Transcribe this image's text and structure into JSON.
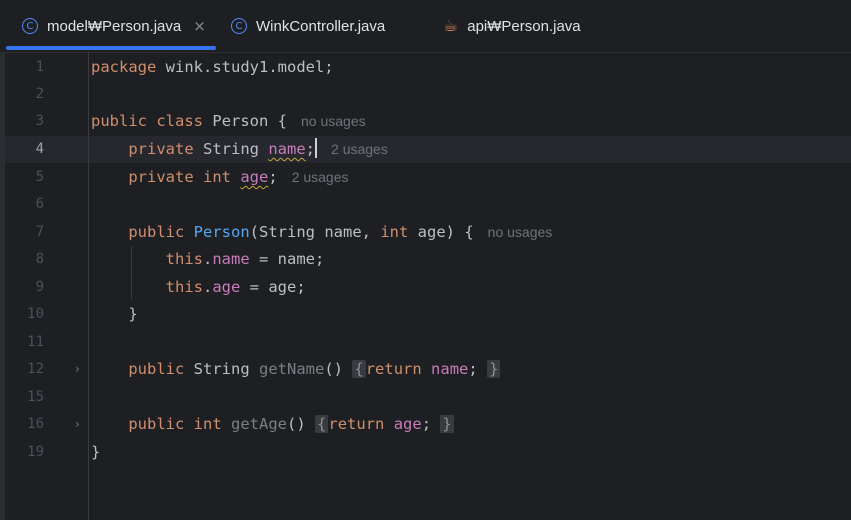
{
  "tabs": [
    {
      "label": "model₩Person.java",
      "icon": "class-icon",
      "active": true,
      "closable": true
    },
    {
      "label": "WinkController.java",
      "icon": "class-icon",
      "active": false
    },
    {
      "label": "api₩Person.java",
      "icon": "java-cup-icon",
      "active": false
    }
  ],
  "editor": {
    "current_line": "4",
    "lines": [
      {
        "num": "1",
        "p": [
          "package",
          "wink.study1.model;"
        ]
      },
      {
        "num": "2"
      },
      {
        "num": "3",
        "p": [
          "public",
          "class",
          "Person {"
        ],
        "hint": "no usages"
      },
      {
        "num": "4",
        "p": [
          "private",
          "String",
          "name",
          ";"
        ],
        "hint": "2 usages"
      },
      {
        "num": "5",
        "p": [
          "private",
          "int",
          "age",
          ";"
        ],
        "hint": "2 usages"
      },
      {
        "num": "6"
      },
      {
        "num": "7",
        "p": [
          "public",
          "Person",
          "(String name, ",
          "int",
          " age) {"
        ],
        "hint": "no usages"
      },
      {
        "num": "8",
        "p": [
          "this",
          ".",
          "name",
          " = name;"
        ]
      },
      {
        "num": "9",
        "p": [
          "this",
          ".",
          "age",
          " = age;"
        ]
      },
      {
        "num": "10",
        "p": [
          "}"
        ]
      },
      {
        "num": "11"
      },
      {
        "num": "12",
        "p": [
          "public",
          "String",
          "getName",
          "()",
          "{",
          "return",
          "name",
          ";",
          "}"
        ]
      },
      {
        "num": "15"
      },
      {
        "num": "16",
        "p": [
          "public",
          "int",
          "getAge",
          "()",
          "{",
          "return",
          "age",
          ";",
          "}"
        ]
      },
      {
        "num": "19",
        "p": [
          "}"
        ]
      }
    ]
  }
}
